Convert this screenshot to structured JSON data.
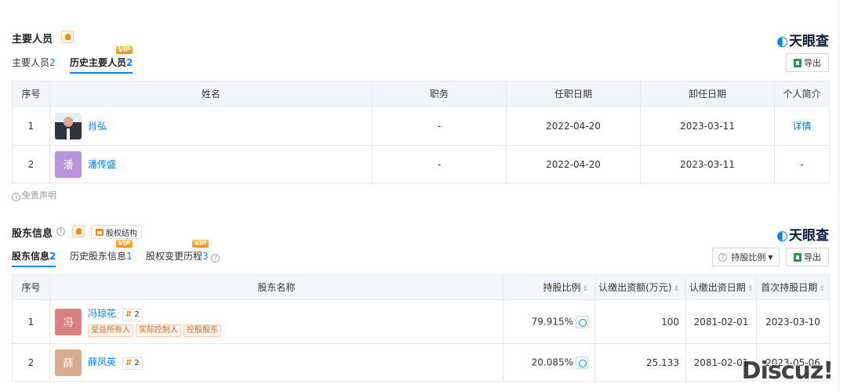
{
  "brand": {
    "logo_text": "天眼查",
    "accent": "#0084ff"
  },
  "personnel": {
    "title": "主要人员",
    "tabs": [
      {
        "label": "主要人员",
        "count": "2",
        "active": false
      },
      {
        "label": "历史主要人员",
        "count": "2",
        "active": true,
        "vip": "VIP"
      }
    ],
    "export_label": "导出",
    "columns": [
      "序号",
      "姓名",
      "职务",
      "任职日期",
      "卸任日期",
      "个人简介"
    ],
    "rows": [
      {
        "index": "1",
        "avatar_char": "",
        "name": "肖弘",
        "position": "-",
        "start": "2022-04-20",
        "end": "2023-03-11",
        "bio": "详情"
      },
      {
        "index": "2",
        "avatar_char": "潘",
        "name": "潘传盛",
        "position": "-",
        "start": "2022-04-20",
        "end": "2023-03-11",
        "bio": "-"
      }
    ],
    "disclaimer": "免责声明"
  },
  "shareholders": {
    "title": "股东信息",
    "structure_label": "股权结构",
    "tabs": [
      {
        "label": "股东信息",
        "count": "2",
        "active": true
      },
      {
        "label": "历史股东信息",
        "count": "1",
        "active": false,
        "vip": "VIP"
      },
      {
        "label": "股权变更历程",
        "count": "3",
        "active": false,
        "vip": "VIP"
      }
    ],
    "ratio_button": "持股比例",
    "export_label": "导出",
    "columns": [
      "序号",
      "股东名称",
      "持股比例",
      "认缴出资额(万元)",
      "认缴出资日期",
      "首次持股日期"
    ],
    "rows": [
      {
        "index": "1",
        "avatar_char": "冯",
        "avatar_color": "#d9827d",
        "name": "冯琼花",
        "badge": "2",
        "tags": [
          "受益所有人",
          "实际控制人",
          "控股股东"
        ],
        "ratio": "79.915%",
        "amount": "100",
        "subscribe_date": "2081-02-01",
        "first_date": "2023-03-10"
      },
      {
        "index": "2",
        "avatar_char": "薛",
        "avatar_color": "#d6ab8f",
        "name": "薛凤英",
        "badge": "2",
        "tags": [],
        "ratio": "20.085%",
        "amount": "25.133",
        "subscribe_date": "2081-02-01",
        "first_date": "2023-05-06"
      }
    ]
  },
  "watermark": "Discuz!"
}
